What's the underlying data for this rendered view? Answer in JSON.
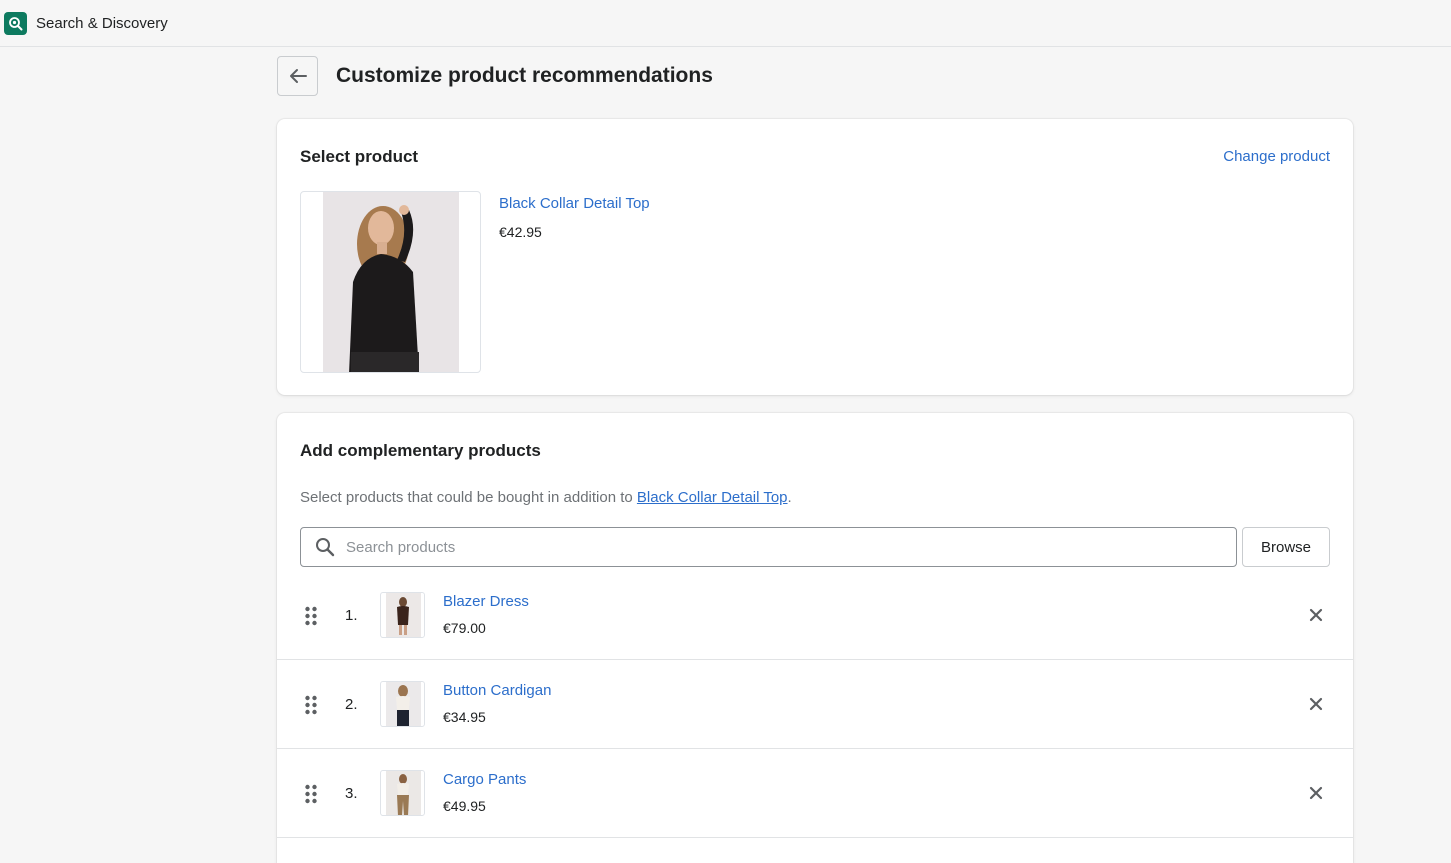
{
  "app": {
    "title": "Search & Discovery",
    "icon": "search-discovery-app-icon"
  },
  "header": {
    "title": "Customize product recommendations",
    "back_icon": "arrow-left-icon"
  },
  "select_product": {
    "heading": "Select product",
    "change_link": "Change product",
    "product": {
      "name": "Black Collar Detail Top",
      "price": "€42.95"
    }
  },
  "complementary": {
    "heading": "Add complementary products",
    "description_prefix": "Select products that could be bought in addition to ",
    "description_link": "Black Collar Detail Top",
    "description_suffix": ".",
    "search": {
      "placeholder": "Search products",
      "value": ""
    },
    "browse_label": "Browse",
    "items": [
      {
        "index": "1.",
        "name": "Blazer Dress",
        "price": "€79.00"
      },
      {
        "index": "2.",
        "name": "Button Cardigan",
        "price": "€34.95"
      },
      {
        "index": "3.",
        "name": "Cargo Pants",
        "price": "€49.95"
      }
    ]
  },
  "colors": {
    "link": "#2c6ecb",
    "app_icon": "#0d7a5f",
    "background": "#f6f6f6"
  }
}
